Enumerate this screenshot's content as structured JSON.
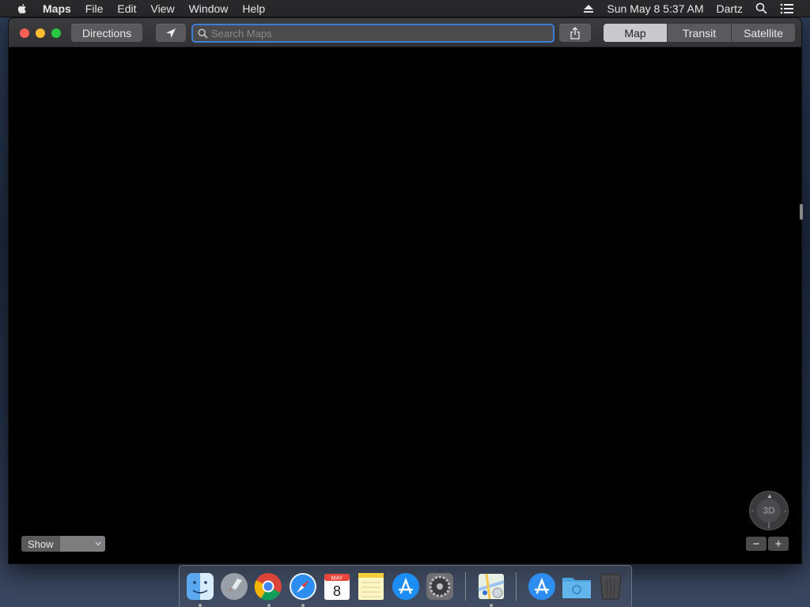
{
  "menubar": {
    "app_name": "Maps",
    "menus": [
      "File",
      "Edit",
      "View",
      "Window",
      "Help"
    ],
    "datetime": "Sun May 8  5:37 AM",
    "user": "Dartz"
  },
  "toolbar": {
    "directions_label": "Directions",
    "search_placeholder": "Search Maps",
    "search_value": "",
    "map_types": [
      {
        "label": "Map",
        "active": true
      },
      {
        "label": "Transit",
        "active": false
      },
      {
        "label": "Satellite",
        "active": false
      }
    ]
  },
  "map": {
    "show_label": "Show",
    "show_value": "",
    "compass_label": "3D",
    "zoom_out": "−",
    "zoom_in": "+"
  },
  "dock": {
    "calendar_month": "MAY",
    "calendar_day": "8",
    "apps": [
      "finder-icon",
      "launchpad-icon",
      "chrome-icon",
      "safari-icon",
      "calendar-icon",
      "notes-icon",
      "app-store-icon",
      "system-preferences-icon",
      "maps-icon",
      "app-store-download-icon",
      "folder-icon",
      "trash-icon"
    ]
  },
  "colors": {
    "accent": "#3d7fd6",
    "close": "#ff5f57",
    "minimize": "#febc2e",
    "zoom": "#28c840"
  }
}
